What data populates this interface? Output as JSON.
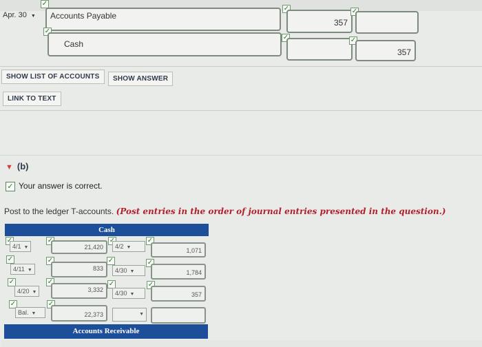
{
  "journal": {
    "date": "Apr. 30",
    "row1_account": "Accounts Payable",
    "row1_debit": "357",
    "row2_account": "Cash",
    "row2_credit": "357"
  },
  "buttons": {
    "show_list": "SHOW LIST OF ACCOUNTS",
    "show_answer": "SHOW ANSWER",
    "link_to_text": "LINK TO TEXT"
  },
  "part_b": {
    "label": "(b)",
    "status": "Your answer is correct.",
    "instruction_plain": "Post to the ledger T-accounts.",
    "instruction_emph": "(Post entries in the order of journal entries presented in the question.)"
  },
  "cash": {
    "title": "Cash",
    "rows": [
      {
        "ldate": "4/1",
        "lamt": "21,420",
        "rdate": "4/2",
        "ramt": "1,071"
      },
      {
        "ldate": "4/11",
        "lamt": "833",
        "rdate": "4/30",
        "ramt": "1,784"
      },
      {
        "ldate": "4/20",
        "lamt": "3,332",
        "rdate": "4/30",
        "ramt": "357"
      },
      {
        "ldate": "Bal.",
        "lamt": "22,373",
        "rdate": "",
        "ramt": ""
      }
    ]
  },
  "ar": {
    "title": "Accounts Receivable"
  },
  "colors": {
    "accent": "#1d4e9a",
    "emphasis": "#b0202a",
    "check": "#2f7b2f"
  }
}
